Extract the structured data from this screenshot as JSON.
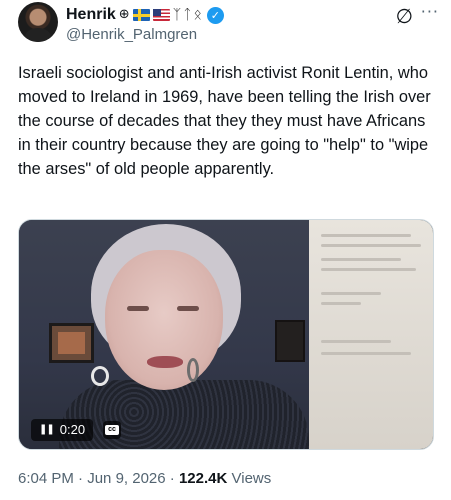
{
  "author": {
    "display_name": "Henrik",
    "emoji_icons": [
      "globe-with-meridians-icon",
      "sweden-flag-icon",
      "usa-flag-icon"
    ],
    "runes": "ᛉᛏᛟ",
    "verified_mark": "✓",
    "handle": "@Henrik_Palmgren"
  },
  "header_actions": {
    "grok_icon": "∅",
    "more_icon": "···"
  },
  "tweet": {
    "text": "Israeli sociologist and anti-Irish activist Ronit Lentin, who moved to Ireland in 1969, have been telling the Irish over the course of decades that they they must have Africans in their country because they are going to \"help\" to \"wipe the arses\" of old people apparently."
  },
  "video": {
    "time": "0:20",
    "pause_icon": "❚❚",
    "cc_label": "cc"
  },
  "meta": {
    "time": "6:04 PM",
    "separator": " · ",
    "date": "Jun 9, 2026",
    "views_count": "122.4K",
    "views_label": "Views"
  },
  "colors": {
    "text": "#0f1419",
    "secondary": "#536471",
    "verified": "#1d9bf0"
  }
}
